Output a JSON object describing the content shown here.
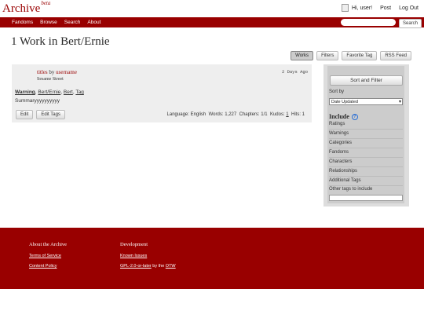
{
  "header": {
    "logo": "Archive",
    "logo_sup": "beta",
    "greeting": "Hi, user!",
    "post": "Post",
    "logout": "Log Out"
  },
  "nav": {
    "items": [
      "Fandoms",
      "Browse",
      "Search",
      "About"
    ],
    "search_button": "Search"
  },
  "page_title": "1 Work in Bert/Ernie",
  "actions": [
    "Works",
    "Filters",
    "Favorite Tag",
    "RSS Feed"
  ],
  "work": {
    "title": "titles",
    "by": "by",
    "author": "username",
    "fandom": "Sesame Street",
    "date": "2 Days Ago",
    "tags": [
      "Warning",
      "Bert/Ernie",
      "Bert",
      "Tag"
    ],
    "summary": "Summaryyyyyyyyyy",
    "edit": "Edit",
    "edit_tags": "Edit Tags",
    "stats": {
      "language_label": "Language:",
      "language": "English",
      "words_label": "Words:",
      "words": "1,227",
      "chapters_label": "Chapters:",
      "chapters": "1/1",
      "kudos_label": "Kudos:",
      "kudos": "1",
      "hits_label": "Hits:",
      "hits": "1"
    }
  },
  "filter": {
    "sort_filter_button": "Sort and Filter",
    "sort_by_label": "Sort by",
    "sort_by_value": "Date Updated",
    "include_heading": "Include",
    "facets": [
      "Ratings",
      "Warnings",
      "Categories",
      "Fandoms",
      "Characters",
      "Relationships",
      "Additional Tags"
    ],
    "other_tags_label": "Other tags to include"
  },
  "footer": {
    "about_heading": "About the Archive",
    "about_links": [
      "Terms of Service",
      "Content Policy"
    ],
    "dev_heading": "Development",
    "dev_links": [
      "Known Issues"
    ],
    "license_link": "GPL-2.0-or-later",
    "license_by": "by the",
    "otw": "OTW"
  }
}
